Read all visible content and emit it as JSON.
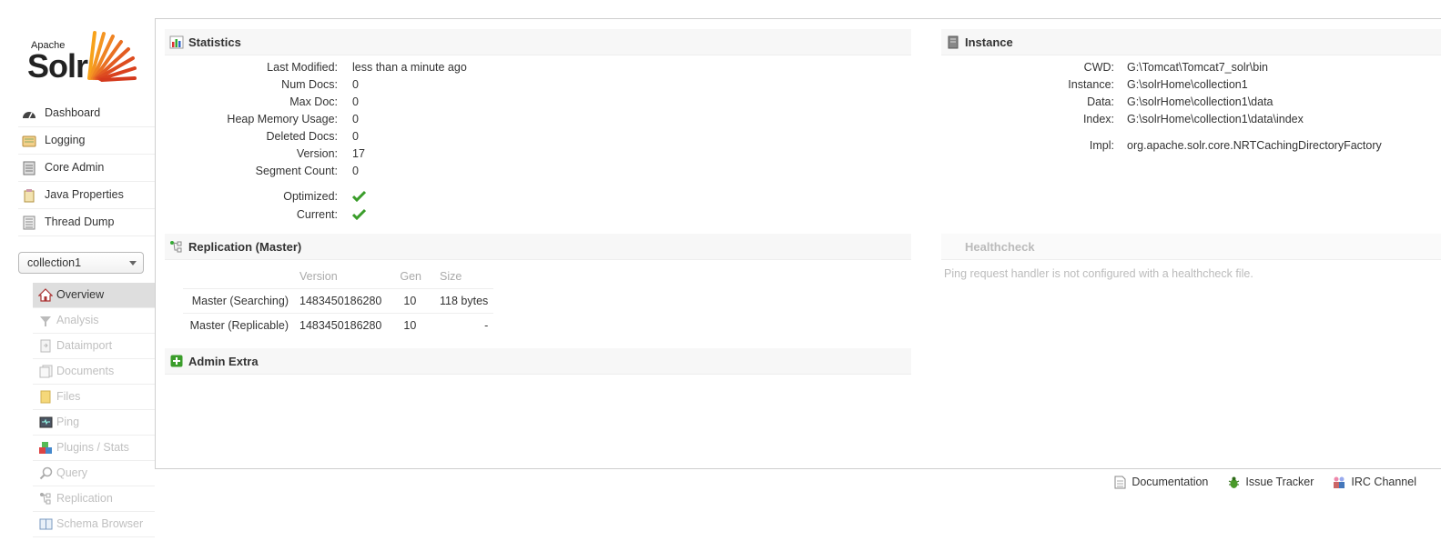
{
  "logo": {
    "apache": "Apache",
    "solr": "Solr",
    "accent": "#d9411e"
  },
  "nav": [
    {
      "label": "Dashboard",
      "icon": "dashboard-icon"
    },
    {
      "label": "Logging",
      "icon": "logging-icon"
    },
    {
      "label": "Core Admin",
      "icon": "core-admin-icon"
    },
    {
      "label": "Java Properties",
      "icon": "java-properties-icon"
    },
    {
      "label": "Thread Dump",
      "icon": "thread-dump-icon"
    }
  ],
  "core_selector": {
    "value": "collection1"
  },
  "core_menu": [
    {
      "label": "Overview",
      "icon": "home-icon"
    },
    {
      "label": "Analysis",
      "icon": "funnel-icon"
    },
    {
      "label": "Dataimport",
      "icon": "dataimport-icon"
    },
    {
      "label": "Documents",
      "icon": "documents-icon"
    },
    {
      "label": "Files",
      "icon": "files-icon"
    },
    {
      "label": "Ping",
      "icon": "ping-icon"
    },
    {
      "label": "Plugins / Stats",
      "icon": "plugins-icon"
    },
    {
      "label": "Query",
      "icon": "query-icon"
    },
    {
      "label": "Replication",
      "icon": "replication-icon"
    },
    {
      "label": "Schema Browser",
      "icon": "schema-icon"
    }
  ],
  "statistics": {
    "title": "Statistics",
    "rows": [
      {
        "k": "Last Modified:",
        "v": "less than a minute ago"
      },
      {
        "k": "Num Docs:",
        "v": "0"
      },
      {
        "k": "Max Doc:",
        "v": "0"
      },
      {
        "k": "Heap Memory Usage:",
        "v": "0"
      },
      {
        "k": "Deleted Docs:",
        "v": "0"
      },
      {
        "k": "Version:",
        "v": "17"
      },
      {
        "k": "Segment Count:",
        "v": "0"
      }
    ],
    "optimized_label": "Optimized:",
    "current_label": "Current:"
  },
  "instance": {
    "title": "Instance",
    "rows": [
      {
        "k": "CWD:",
        "v": "G:\\Tomcat\\Tomcat7_solr\\bin"
      },
      {
        "k": "Instance:",
        "v": "G:\\solrHome\\collection1"
      },
      {
        "k": "Data:",
        "v": "G:\\solrHome\\collection1\\data"
      },
      {
        "k": "Index:",
        "v": "G:\\solrHome\\collection1\\data\\index"
      }
    ],
    "impl_label": "Impl:",
    "impl_value": "org.apache.solr.core.NRTCachingDirectoryFactory"
  },
  "replication": {
    "title": "Replication (Master)",
    "headers": [
      "",
      "Version",
      "Gen",
      "Size"
    ],
    "rows": [
      [
        "Master (Searching)",
        "1483450186280",
        "10",
        "118 bytes"
      ],
      [
        "Master (Replicable)",
        "1483450186280",
        "10",
        "-"
      ]
    ]
  },
  "healthcheck": {
    "title": "Healthcheck",
    "message": "Ping request handler is not configured with a healthcheck file."
  },
  "admin_extra": {
    "title": "Admin Extra"
  },
  "footer": [
    {
      "label": "Documentation",
      "icon": "documentation-icon"
    },
    {
      "label": "Issue Tracker",
      "icon": "bug-icon"
    },
    {
      "label": "IRC Channel",
      "icon": "irc-icon"
    }
  ]
}
